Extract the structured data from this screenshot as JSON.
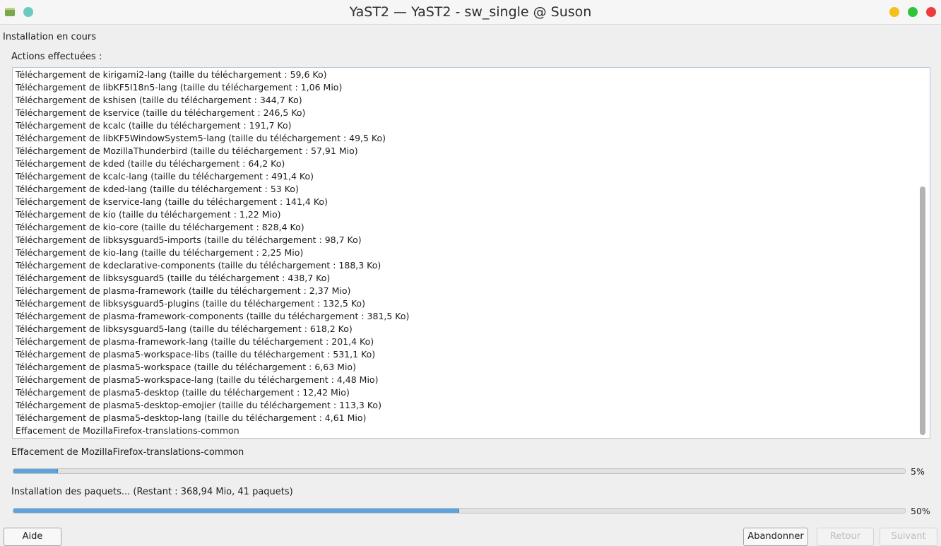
{
  "window": {
    "title": "YaST2 — YaST2 - sw_single @ Suson"
  },
  "dialog": {
    "heading": "Installation en cours",
    "log_label": "Actions effectuées :",
    "log": [
      "Téléchargement de kirigami2-lang (taille du téléchargement : 59,6 Ko)",
      "Téléchargement de libKF5I18n5-lang (taille du téléchargement : 1,06 Mio)",
      "Téléchargement de kshisen (taille du téléchargement : 344,7 Ko)",
      "Téléchargement de kservice (taille du téléchargement : 246,5 Ko)",
      "Téléchargement de kcalc (taille du téléchargement : 191,7 Ko)",
      "Téléchargement de libKF5WindowSystem5-lang (taille du téléchargement : 49,5 Ko)",
      "Téléchargement de MozillaThunderbird (taille du téléchargement : 57,91 Mio)",
      "Téléchargement de kded (taille du téléchargement : 64,2 Ko)",
      "Téléchargement de kcalc-lang (taille du téléchargement : 491,4 Ko)",
      "Téléchargement de kded-lang (taille du téléchargement : 53 Ko)",
      "Téléchargement de kservice-lang (taille du téléchargement : 141,4 Ko)",
      "Téléchargement de kio (taille du téléchargement : 1,22 Mio)",
      "Téléchargement de kio-core (taille du téléchargement : 828,4 Ko)",
      "Téléchargement de libksysguard5-imports (taille du téléchargement : 98,7 Ko)",
      "Téléchargement de kio-lang (taille du téléchargement : 2,25 Mio)",
      "Téléchargement de kdeclarative-components (taille du téléchargement : 188,3 Ko)",
      "Téléchargement de libksysguard5 (taille du téléchargement : 438,7 Ko)",
      "Téléchargement de plasma-framework (taille du téléchargement : 2,37 Mio)",
      "Téléchargement de libksysguard5-plugins (taille du téléchargement : 132,5 Ko)",
      "Téléchargement de plasma-framework-components (taille du téléchargement : 381,5 Ko)",
      "Téléchargement de libksysguard5-lang (taille du téléchargement : 618,2 Ko)",
      "Téléchargement de plasma-framework-lang (taille du téléchargement : 201,4 Ko)",
      "Téléchargement de plasma5-workspace-libs (taille du téléchargement : 531,1 Ko)",
      "Téléchargement de plasma5-workspace (taille du téléchargement : 6,63 Mio)",
      "Téléchargement de plasma5-workspace-lang (taille du téléchargement : 4,48 Mio)",
      "Téléchargement de plasma5-desktop (taille du téléchargement : 12,42 Mio)",
      "Téléchargement de plasma5-desktop-emojier (taille du téléchargement : 113,3 Ko)",
      "Téléchargement de plasma5-desktop-lang (taille du téléchargement : 4,61 Mio)",
      "Effacement de MozillaFirefox-translations-common"
    ],
    "current": {
      "label": "Effacement de MozillaFirefox-translations-common",
      "progress": 5,
      "percent_text": "5%"
    },
    "total": {
      "label": "Installation des paquets... (Restant : 368,94 Mio, 41 paquets)",
      "progress": 50,
      "percent_text": "50%"
    }
  },
  "buttons": {
    "help": "Aide",
    "abort": "Abandonner",
    "back": "Retour",
    "next": "Suivant"
  },
  "colors": {
    "progress_fill": "#5ea2de",
    "minimize": "#f4c01a",
    "maximize": "#2fc43a",
    "close": "#ef3b3b"
  }
}
